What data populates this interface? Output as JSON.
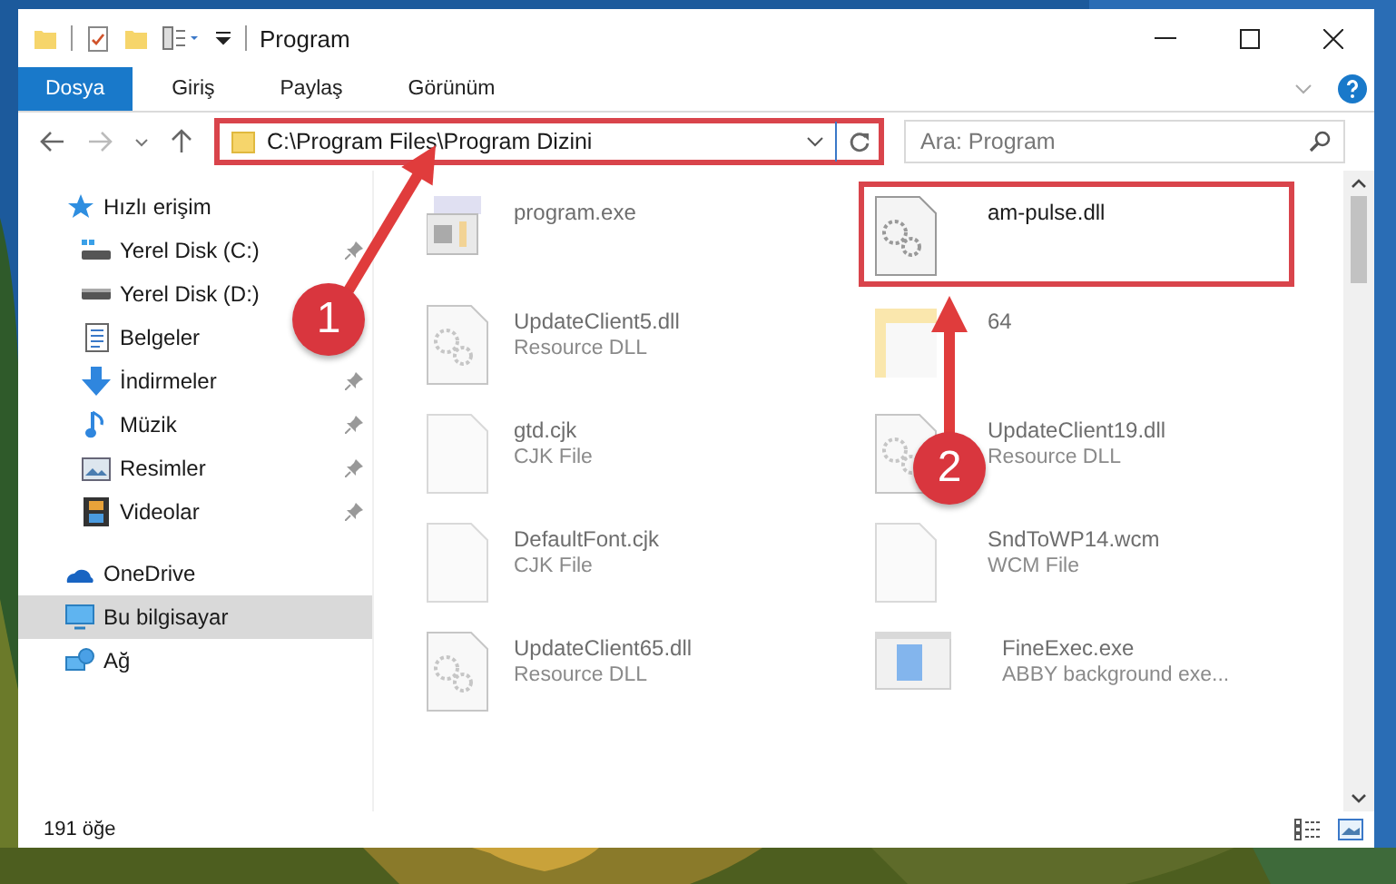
{
  "window": {
    "title": "Program"
  },
  "ribbon": {
    "tabs": [
      {
        "label": "Dosya",
        "selected": true
      },
      {
        "label": "Giriş",
        "selected": false
      },
      {
        "label": "Paylaş",
        "selected": false
      },
      {
        "label": "Görünüm",
        "selected": false
      }
    ]
  },
  "address": {
    "path": "C:\\Program Files\\Program Dizini",
    "highlighted": true
  },
  "search": {
    "placeholder": "Ara: Program"
  },
  "navigation": {
    "items": [
      {
        "label": "Hızlı erişim",
        "selected": false,
        "children": [
          {
            "label": "Yerel Disk (C:)",
            "pinned": true,
            "selected": false
          },
          {
            "label": "Yerel Disk (D:)",
            "pinned": false,
            "selected": false
          },
          {
            "label": "Belgeler",
            "pinned": false,
            "selected": false
          },
          {
            "label": "İndirmeler",
            "pinned": true,
            "selected": false
          },
          {
            "label": "Müzik",
            "pinned": true,
            "selected": false
          },
          {
            "label": "Resimler",
            "pinned": true,
            "selected": false
          },
          {
            "label": "Videolar",
            "pinned": true,
            "selected": false
          }
        ]
      },
      {
        "label": "OneDrive",
        "selected": false
      },
      {
        "label": "Bu bilgisayar",
        "selected": true
      },
      {
        "label": "Ağ",
        "selected": false
      }
    ]
  },
  "files": [
    {
      "name": "program.exe",
      "kind": "exe",
      "dimmed": true,
      "highlighted": false
    },
    {
      "name": "am-pulse.dll",
      "kind": "dll",
      "dimmed": false,
      "highlighted": true
    },
    {
      "name": "UpdateClient5.dll",
      "type": "Resource DLL",
      "kind": "dll",
      "dimmed": true,
      "highlighted": false
    },
    {
      "name": "64",
      "kind": "folder",
      "dimmed": true,
      "highlighted": false
    },
    {
      "name": "gtd.cjk",
      "type": "CJK File",
      "kind": "blank",
      "dimmed": true,
      "highlighted": false
    },
    {
      "name": "UpdateClient19.dll",
      "type": "Resource DLL",
      "kind": "dll",
      "dimmed": true,
      "highlighted": false
    },
    {
      "name": "DefaultFont.cjk",
      "type": "CJK File",
      "kind": "blank",
      "dimmed": true,
      "highlighted": false
    },
    {
      "name": "SndToWP14.wcm",
      "type": "WCM File",
      "kind": "blank",
      "dimmed": true,
      "highlighted": false
    },
    {
      "name": "UpdateClient65.dll",
      "type": "Resource DLL",
      "kind": "dll",
      "dimmed": true,
      "highlighted": false
    },
    {
      "name": "FineExec.exe",
      "type": "ABBY background exe...",
      "kind": "app",
      "dimmed": true,
      "highlighted": false
    }
  ],
  "status_bar": {
    "count": "191 öğe"
  },
  "annotations": [
    {
      "number": "1"
    },
    {
      "number": "2"
    }
  ]
}
